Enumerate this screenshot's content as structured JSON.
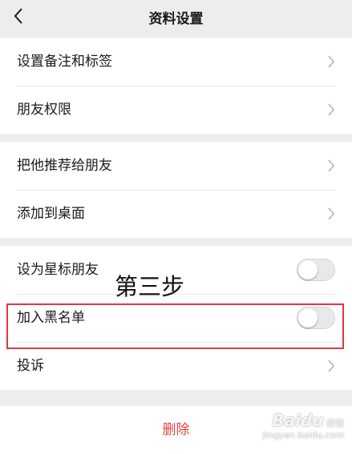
{
  "navbar": {
    "title": "资料设置",
    "back_icon": "chevron-left-icon"
  },
  "groups": [
    {
      "items": [
        {
          "label": "设置备注和标签",
          "control": "chevron-right-icon"
        },
        {
          "label": "朋友权限",
          "control": "chevron-right-icon"
        }
      ]
    },
    {
      "items": [
        {
          "label": "把他推荐给朋友",
          "control": "chevron-right-icon"
        },
        {
          "label": "添加到桌面",
          "control": "chevron-right-icon"
        }
      ]
    },
    {
      "items": [
        {
          "label": "设为星标朋友",
          "control": "toggle",
          "on": false
        },
        {
          "label": "加入黑名单",
          "control": "toggle",
          "on": false
        },
        {
          "label": "投诉",
          "control": "chevron-right-icon"
        }
      ]
    }
  ],
  "delete_label": "删除",
  "annotation": {
    "text": "第三步",
    "highlight_color": "#e0393e"
  },
  "watermark": {
    "brand": "Baidu",
    "brand_cn": "经验",
    "url": "jingyan.baidu.com"
  },
  "colors": {
    "background": "#ededed",
    "danger": "#e64340"
  }
}
